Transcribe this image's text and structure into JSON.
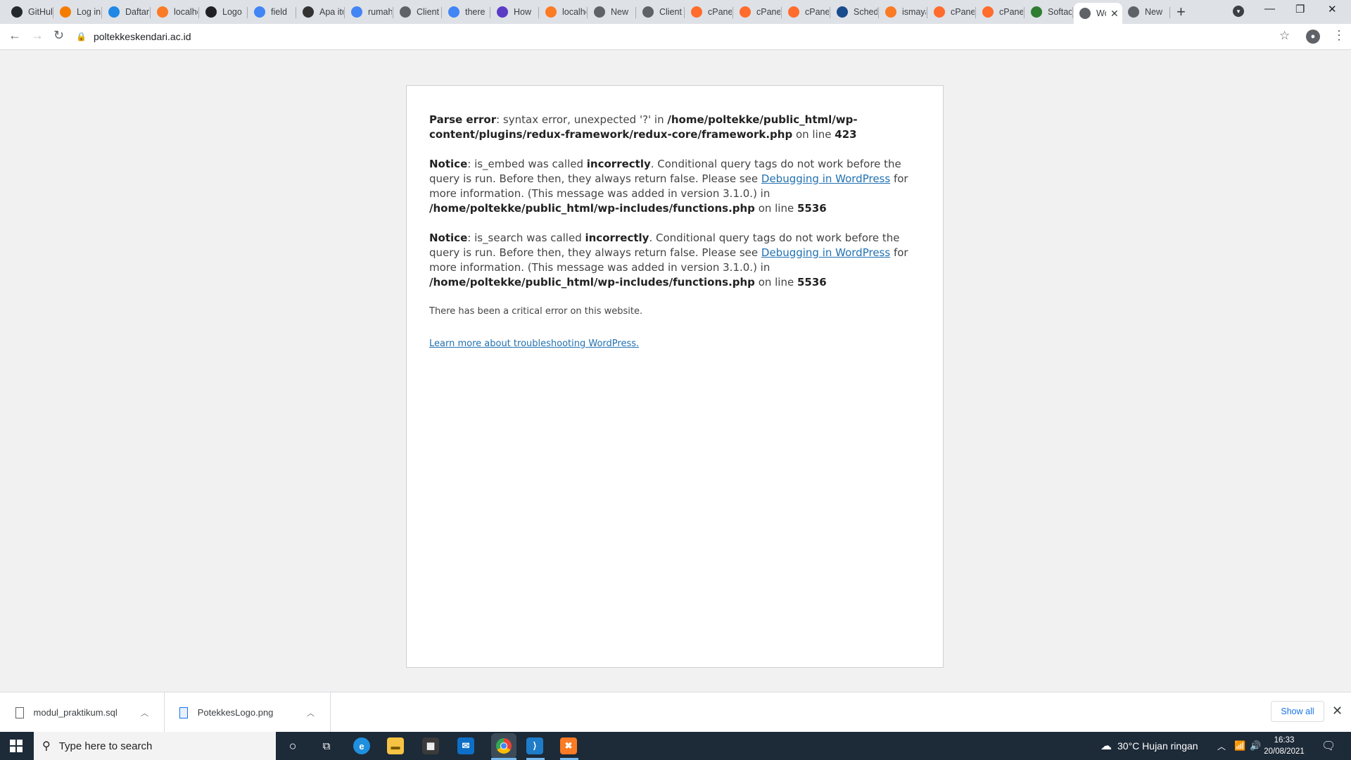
{
  "browser": {
    "tabs": [
      {
        "label": "GitHub",
        "icon": "github-icon",
        "color": "#24292e"
      },
      {
        "label": "Log in",
        "icon": "blogger-icon",
        "color": "#f57c00"
      },
      {
        "label": "Daftar",
        "icon": "code-icon",
        "color": "#1e88e5"
      },
      {
        "label": "localhost",
        "icon": "xampp-icon",
        "color": "#fb7a24"
      },
      {
        "label": "Logo",
        "icon": "circle-icon",
        "color": "#202124"
      },
      {
        "label": "field",
        "icon": "google-icon",
        "color": "#4285f4"
      },
      {
        "label": "Apa itu",
        "icon": "quora-icon",
        "color": "#333333"
      },
      {
        "label": "rumah",
        "icon": "google-icon",
        "color": "#4285f4"
      },
      {
        "label": "Client",
        "icon": "globe-icon",
        "color": "#5f6368"
      },
      {
        "label": "there",
        "icon": "google-icon",
        "color": "#4285f4"
      },
      {
        "label": "How",
        "icon": "k-icon",
        "color": "#5b3cc4"
      },
      {
        "label": "localhost",
        "icon": "xampp-icon",
        "color": "#fb7a24"
      },
      {
        "label": "New",
        "icon": "globe-icon",
        "color": "#5f6368"
      },
      {
        "label": "Client",
        "icon": "globe-icon",
        "color": "#5f6368"
      },
      {
        "label": "cPanel",
        "icon": "cpanel-icon",
        "color": "#ff6c2c"
      },
      {
        "label": "cPanel",
        "icon": "cpanel-icon",
        "color": "#ff6c2c"
      },
      {
        "label": "cPanel",
        "icon": "cpanel-icon",
        "color": "#ff6c2c"
      },
      {
        "label": "Schedule",
        "icon": "schedule-icon",
        "color": "#1a4b8c"
      },
      {
        "label": "ismaya",
        "icon": "xampp-icon",
        "color": "#fb7a24"
      },
      {
        "label": "cPanel",
        "icon": "cpanel-icon",
        "color": "#ff6c2c"
      },
      {
        "label": "cPanel",
        "icon": "cpanel-icon",
        "color": "#ff6c2c"
      },
      {
        "label": "Softaculous",
        "icon": "softaculous-icon",
        "color": "#2e7d32"
      },
      {
        "label": "WordPress",
        "icon": "globe-icon",
        "color": "#5f6368",
        "active": true
      },
      {
        "label": "New",
        "icon": "globe-icon",
        "color": "#5f6368"
      }
    ],
    "new_tab": "+",
    "address": "poltekkeskendari.ac.id"
  },
  "page": {
    "parse_label": "Parse error",
    "parse_text": ": syntax error, unexpected '?' in ",
    "parse_path": "/home/poltekke/public_html/wp-content/plugins/redux-framework/redux-core/framework.php",
    "parse_online": " on line ",
    "parse_line": "423",
    "notices": [
      {
        "label": "Notice",
        "pre": ": is_embed was called ",
        "strong": "incorrectly",
        "mid": ". Conditional query tags do not work before the query is run. Before then, they always return false. Please see ",
        "link": "Debugging in WordPress",
        "post": " for more information. (This message was added in version 3.1.0.) in ",
        "path": "/home/poltekke/public_html/wp-includes/functions.php",
        "online": " on line ",
        "line": "5536"
      },
      {
        "label": "Notice",
        "pre": ": is_search was called ",
        "strong": "incorrectly",
        "mid": ". Conditional query tags do not work before the query is run. Before then, they always return false. Please see ",
        "link": "Debugging in WordPress",
        "post": " for more information. (This message was added in version 3.1.0.) in ",
        "path": "/home/poltekke/public_html/wp-includes/functions.php",
        "online": " on line ",
        "line": "5536"
      }
    ],
    "critical": "There has been a critical error on this website.",
    "learn_more": "Learn more about troubleshooting WordPress."
  },
  "downloads": {
    "items": [
      "modul_praktikum.sql",
      "PotekkesLogo.png"
    ],
    "show_all": "Show all"
  },
  "taskbar": {
    "search_placeholder": "Type here to search",
    "weather": "30°C  Hujan ringan",
    "time": "16:33",
    "date": "20/08/2021"
  }
}
